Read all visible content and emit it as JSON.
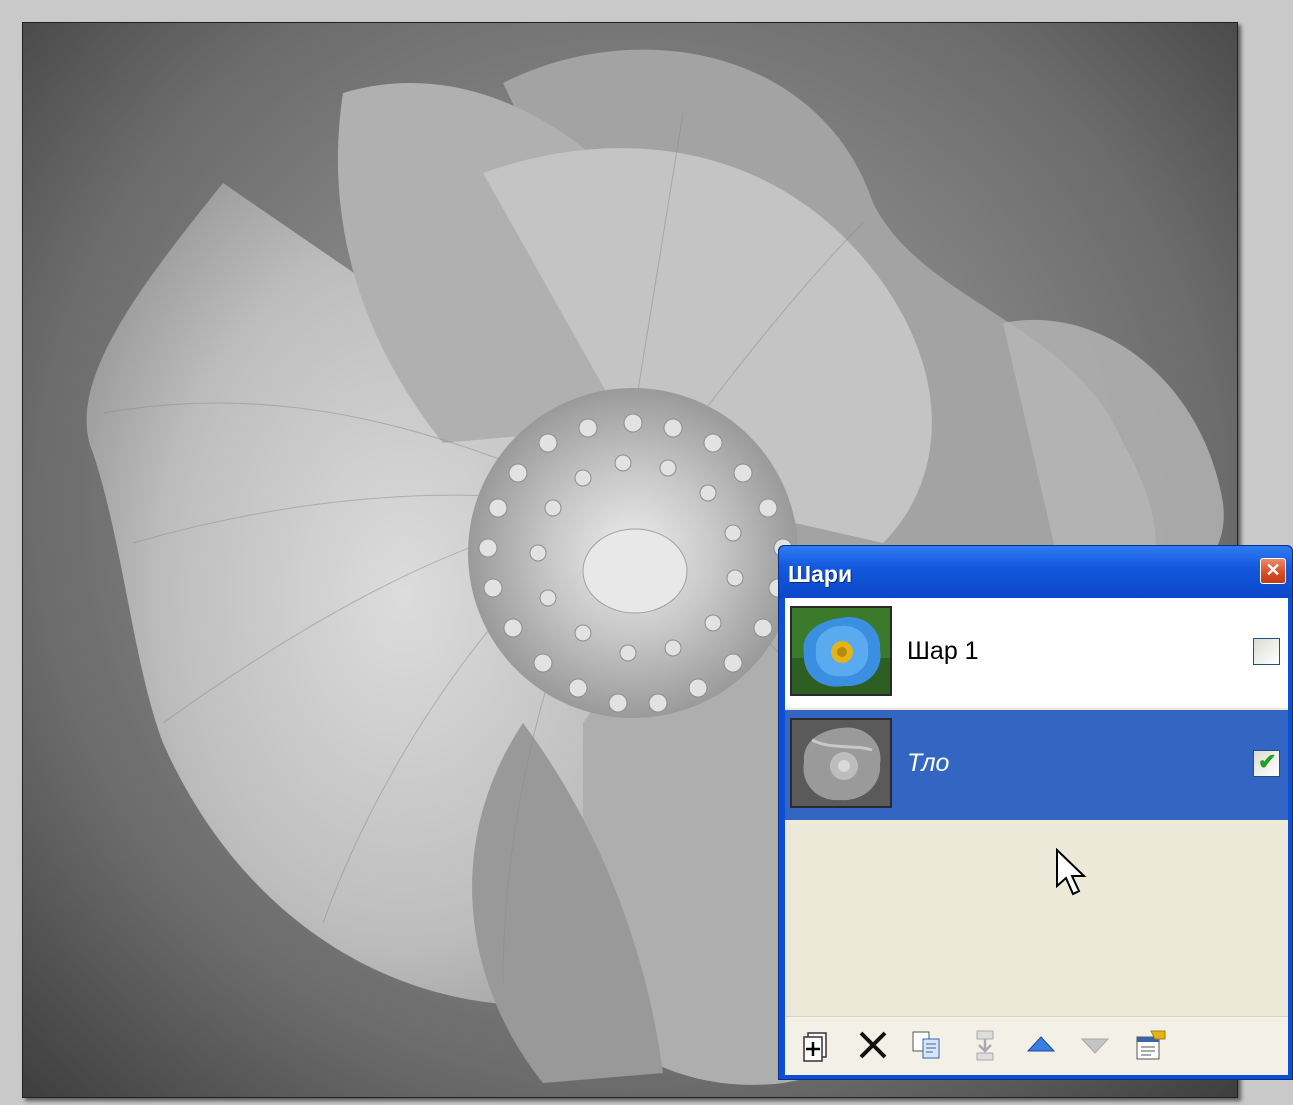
{
  "canvas": {
    "image": "grayscale-poppy-photo"
  },
  "layers_panel": {
    "title": "Шари",
    "close_icon": "close-icon",
    "layers": [
      {
        "name": "Шар 1",
        "visible": false,
        "selected": false,
        "thumbnail": "blue-poppy-thumbnail"
      },
      {
        "name": "Тло",
        "visible": true,
        "selected": true,
        "thumbnail": "grayscale-poppy-thumbnail"
      }
    ],
    "toolbar": [
      {
        "name": "add-layer-icon",
        "enabled": true
      },
      {
        "name": "delete-layer-icon",
        "enabled": true
      },
      {
        "name": "duplicate-layer-icon",
        "enabled": true
      },
      {
        "name": "merge-layer-down-icon",
        "enabled": false
      },
      {
        "name": "move-layer-up-icon",
        "enabled": true
      },
      {
        "name": "move-layer-down-icon",
        "enabled": false
      },
      {
        "name": "layer-properties-icon",
        "enabled": true
      }
    ]
  },
  "colors": {
    "title_bar": "#0b4fd4",
    "selected_row": "#3365c3",
    "panel_background": "#ece9d8"
  }
}
